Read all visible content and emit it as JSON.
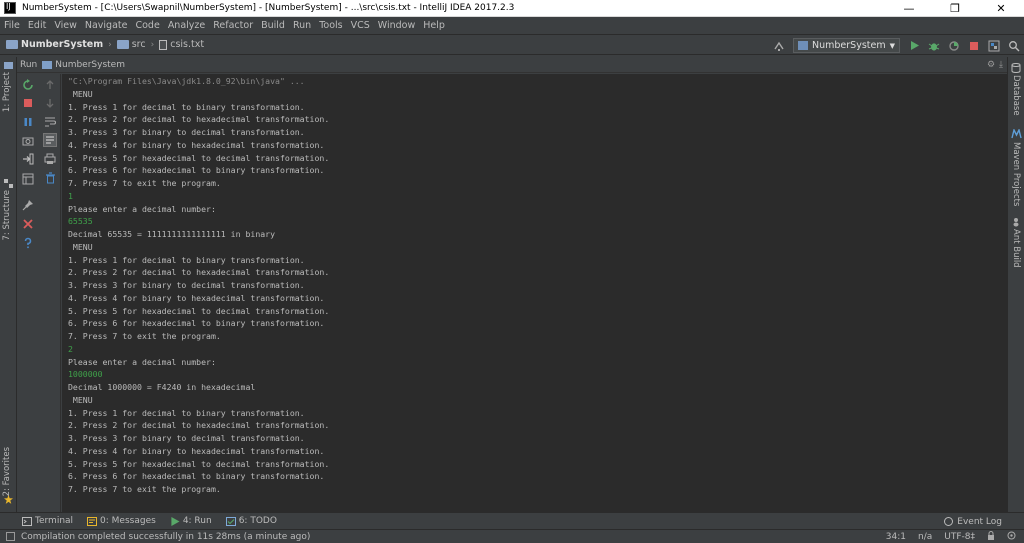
{
  "window": {
    "title": "NumberSystem - [C:\\Users\\Swapnil\\NumberSystem] - [NumberSystem] - ...\\src\\csis.txt - IntelliJ IDEA 2017.2.3",
    "minimize": "—",
    "maximize": "❐",
    "close": "✕"
  },
  "menu": [
    "File",
    "Edit",
    "View",
    "Navigate",
    "Code",
    "Analyze",
    "Refactor",
    "Build",
    "Run",
    "Tools",
    "VCS",
    "Window",
    "Help"
  ],
  "breadcrumb": {
    "project": "NumberSystem",
    "folder": "src",
    "file": "csis.txt",
    "separator": "›"
  },
  "run_config": {
    "label": "NumberSystem",
    "caret": "▼"
  },
  "left_strip": {
    "project_tab": "1: Project",
    "structure_tab": "7: Structure",
    "favorites_tab": "2: Favorites"
  },
  "right_strip": {
    "database_tab": "Database",
    "maven_tab": "Maven Projects",
    "ant_tab": "Ant Build"
  },
  "run_window": {
    "run_label": "Run",
    "tab_label": "NumberSystem",
    "settings_glyph": "⚙",
    "hide_glyph": "⤓"
  },
  "console": {
    "lines": [
      {
        "t": "\"C:\\Program Files\\Java\\jdk1.8.0_92\\bin\\java\" ...",
        "k": "cmd"
      },
      {
        "t": " MENU",
        "k": "out"
      },
      {
        "t": "1. Press 1 for decimal to binary transformation.",
        "k": "out"
      },
      {
        "t": "2. Press 2 for decimal to hexadecimal transformation.",
        "k": "out"
      },
      {
        "t": "3. Press 3 for binary to decimal transformation.",
        "k": "out"
      },
      {
        "t": "4. Press 4 for binary to hexadecimal transformation.",
        "k": "out"
      },
      {
        "t": "5. Press 5 for hexadecimal to decimal transformation.",
        "k": "out"
      },
      {
        "t": "6. Press 6 for hexadecimal to binary transformation.",
        "k": "out"
      },
      {
        "t": "7. Press 7 to exit the program.",
        "k": "out"
      },
      {
        "t": "1",
        "k": "input"
      },
      {
        "t": "Please enter a decimal number:",
        "k": "out"
      },
      {
        "t": "65535",
        "k": "input"
      },
      {
        "t": "Decimal 65535 = 1111111111111111 in binary",
        "k": "out"
      },
      {
        "t": " MENU",
        "k": "out"
      },
      {
        "t": "1. Press 1 for decimal to binary transformation.",
        "k": "out"
      },
      {
        "t": "2. Press 2 for decimal to hexadecimal transformation.",
        "k": "out"
      },
      {
        "t": "3. Press 3 for binary to decimal transformation.",
        "k": "out"
      },
      {
        "t": "4. Press 4 for binary to hexadecimal transformation.",
        "k": "out"
      },
      {
        "t": "5. Press 5 for hexadecimal to decimal transformation.",
        "k": "out"
      },
      {
        "t": "6. Press 6 for hexadecimal to binary transformation.",
        "k": "out"
      },
      {
        "t": "7. Press 7 to exit the program.",
        "k": "out"
      },
      {
        "t": "2",
        "k": "input"
      },
      {
        "t": "Please enter a decimal number:",
        "k": "out"
      },
      {
        "t": "1000000",
        "k": "input"
      },
      {
        "t": "Decimal 1000000 = F4240 in hexadecimal",
        "k": "out"
      },
      {
        "t": " MENU",
        "k": "out"
      },
      {
        "t": "1. Press 1 for decimal to binary transformation.",
        "k": "out"
      },
      {
        "t": "2. Press 2 for decimal to hexadecimal transformation.",
        "k": "out"
      },
      {
        "t": "3. Press 3 for binary to decimal transformation.",
        "k": "out"
      },
      {
        "t": "4. Press 4 for binary to hexadecimal transformation.",
        "k": "out"
      },
      {
        "t": "5. Press 5 for hexadecimal to decimal transformation.",
        "k": "out"
      },
      {
        "t": "6. Press 6 for hexadecimal to binary transformation.",
        "k": "out"
      },
      {
        "t": "7. Press 7 to exit the program.",
        "k": "out"
      }
    ],
    "colors": {
      "out": "#bbbbbb",
      "cmd": "#8a8a8a",
      "input": "#3fa14a"
    }
  },
  "bottom_tabs": {
    "terminal": "Terminal",
    "messages": "0: Messages",
    "run": "4: Run",
    "todo": "6: TODO",
    "event_log": "Event Log"
  },
  "status": {
    "message": "Compilation completed successfully in 11s 28ms (a minute ago)",
    "position": "34:1",
    "line_sep": "n/a",
    "encoding": "UTF-8‡"
  },
  "icons": {
    "run": "run-icon",
    "debug": "debug-icon",
    "stop": "stop-icon",
    "search": "search-icon"
  },
  "accent_colors": {
    "run_green": "#59a869",
    "stop_red": "#db5c5c",
    "blue": "#4a88c7"
  }
}
